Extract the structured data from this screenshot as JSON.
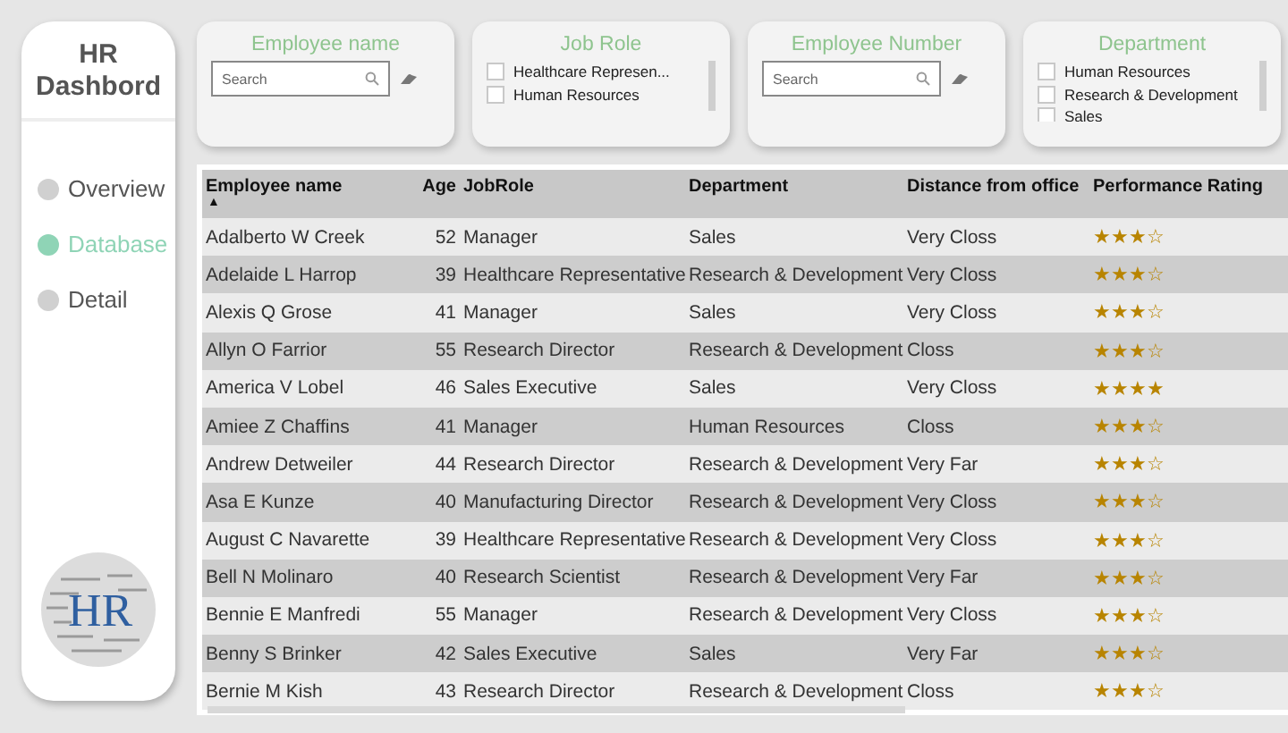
{
  "sidebar": {
    "title": "HR Dashbord",
    "items": [
      {
        "label": "Overview",
        "selected": false
      },
      {
        "label": "Database",
        "selected": true
      },
      {
        "label": "Detail",
        "selected": false
      }
    ],
    "logo_text": "HR"
  },
  "filters": [
    {
      "kind": "search",
      "title": "Employee name",
      "placeholder": "Search"
    },
    {
      "kind": "list",
      "title": "Job Role",
      "options": [
        {
          "label": "Healthcare Represen...",
          "checked": false
        },
        {
          "label": "Human Resources",
          "checked": false
        }
      ]
    },
    {
      "kind": "search",
      "title": "Employee Number",
      "placeholder": "Search"
    },
    {
      "kind": "list",
      "title": "Department",
      "options": [
        {
          "label": "Human Resources",
          "checked": false
        },
        {
          "label": "Research & Development",
          "checked": false
        },
        {
          "label": "Sales",
          "checked": false
        }
      ]
    }
  ],
  "table": {
    "columns": [
      "Employee name",
      "Age",
      "JobRole",
      "Department",
      "Distance from office",
      "Performance Rating"
    ],
    "sort_mark": "▲",
    "rows": [
      {
        "name": "Adalberto W Creek",
        "age": "52",
        "role": "Manager",
        "department": "Sales",
        "distance": "Very Closs",
        "stars": 3
      },
      {
        "name": "Adelaide L Harrop",
        "age": "39",
        "role": "Healthcare Representative",
        "department": "Research & Development",
        "distance": "Very Closs",
        "stars": 3
      },
      {
        "name": "Alexis Q Grose",
        "age": "41",
        "role": "Manager",
        "department": "Sales",
        "distance": "Very Closs",
        "stars": 3
      },
      {
        "name": "Allyn O Farrior",
        "age": "55",
        "role": "Research Director",
        "department": "Research & Development",
        "distance": "Closs",
        "stars": 3
      },
      {
        "name": "America V Lobel",
        "age": "46",
        "role": "Sales Executive",
        "department": "Sales",
        "distance": "Very Closs",
        "stars": 4
      },
      {
        "name": "Amiee Z Chaffins",
        "age": "41",
        "role": "Manager",
        "department": "Human Resources",
        "distance": "Closs",
        "stars": 3
      },
      {
        "name": "Andrew Detweiler",
        "age": "44",
        "role": "Research Director",
        "department": "Research & Development",
        "distance": "Very Far",
        "stars": 3
      },
      {
        "name": "Asa E Kunze",
        "age": "40",
        "role": "Manufacturing Director",
        "department": "Research & Development",
        "distance": "Very Closs",
        "stars": 3
      },
      {
        "name": "August C Navarette",
        "age": "39",
        "role": "Healthcare Representative",
        "department": "Research & Development",
        "distance": "Very Closs",
        "stars": 3
      },
      {
        "name": "Bell N Molinaro",
        "age": "40",
        "role": "Research Scientist",
        "department": "Research & Development",
        "distance": "Very Far",
        "stars": 3
      },
      {
        "name": "Bennie E Manfredi",
        "age": "55",
        "role": "Manager",
        "department": "Research & Development",
        "distance": "Very Closs",
        "stars": 3
      },
      {
        "name": "Benny S Brinker",
        "age": "42",
        "role": "Sales Executive",
        "department": "Sales",
        "distance": "Very Far",
        "stars": 3
      },
      {
        "name": "Bernie M Kish",
        "age": "43",
        "role": "Research Director",
        "department": "Research & Development",
        "distance": "Closs",
        "stars": 3
      }
    ]
  }
}
